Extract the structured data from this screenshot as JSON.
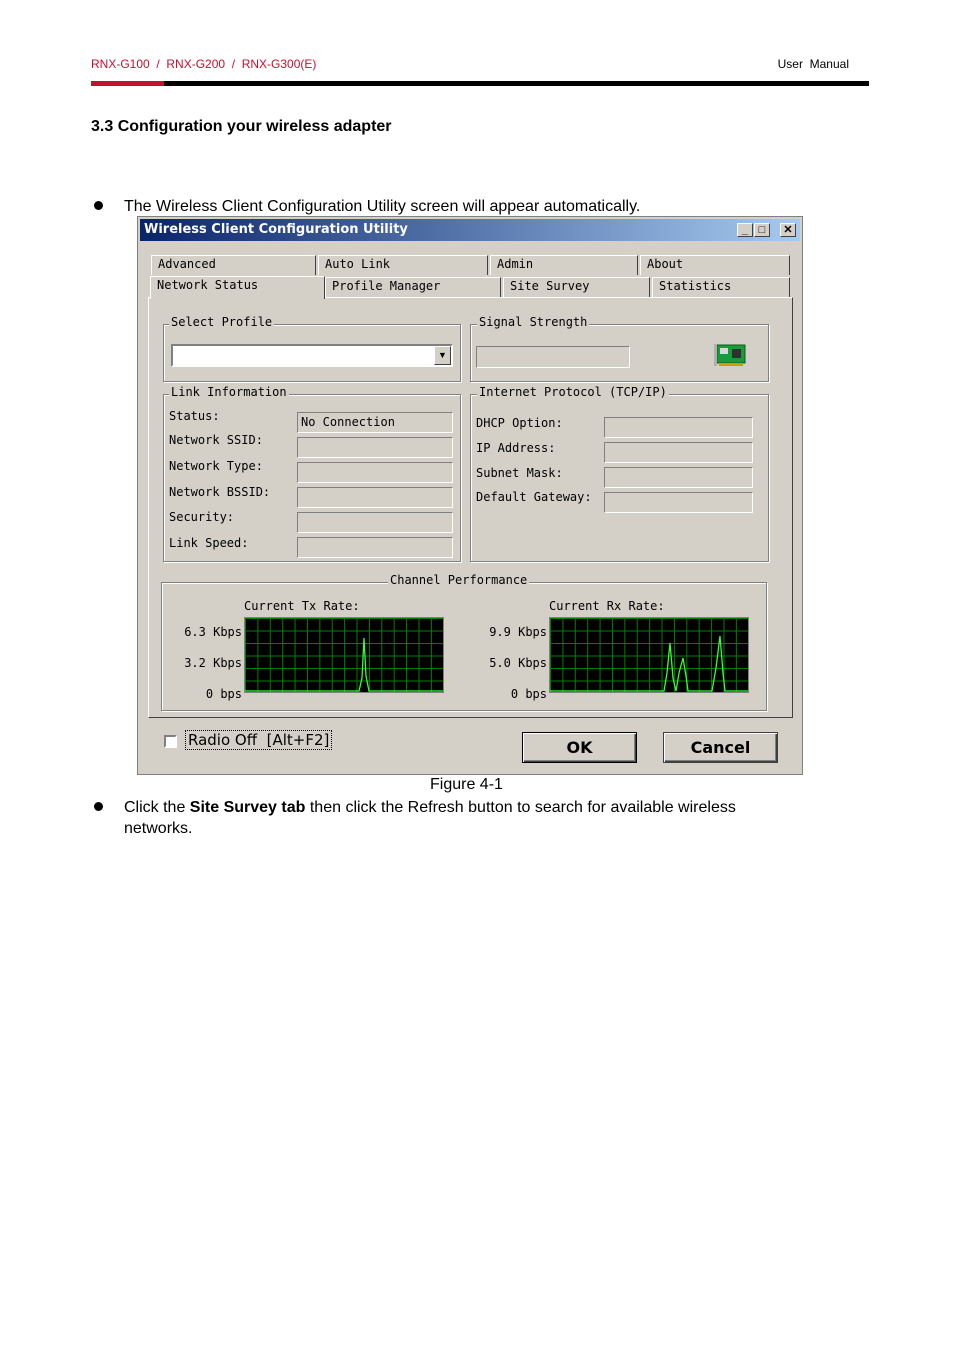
{
  "header": {
    "models": "RNX-G100  /  RNX-G200  /  RNX-G300(E)",
    "manual": "User  Manual"
  },
  "section_title": "3.3 Configuration your wireless adapter",
  "bullets": {
    "first": "The Wireless Client Configuration Utility screen will appear automatically.",
    "second_pre": "Click the ",
    "second_bold": "Site Survey tab",
    "second_post": " then click the Refresh button to search for available wireless",
    "second_line2": "networks."
  },
  "caption": "Figure 4-1",
  "dialog": {
    "title": "Wireless Client Configuration Utility",
    "tabs_back": [
      "Advanced",
      "Auto Link",
      "Admin",
      "About"
    ],
    "tabs_front": [
      "Network Status",
      "Profile Manager",
      "Site Survey",
      "Statistics"
    ],
    "select_profile": {
      "label": "Select Profile",
      "value": ""
    },
    "signal_strength": {
      "label": "Signal Strength"
    },
    "link_info": {
      "label": "Link Information",
      "rows": [
        {
          "label": "Status:",
          "value": "No Connection"
        },
        {
          "label": "Network SSID:",
          "value": ""
        },
        {
          "label": "Network Type:",
          "value": ""
        },
        {
          "label": "Network BSSID:",
          "value": ""
        },
        {
          "label": "Security:",
          "value": ""
        },
        {
          "label": "Link Speed:",
          "value": ""
        }
      ]
    },
    "tcpip": {
      "label": "Internet Protocol  (TCP/IP)",
      "rows": [
        {
          "label": "DHCP Option:",
          "value": ""
        },
        {
          "label": "IP Address:",
          "value": ""
        },
        {
          "label": "Subnet Mask:",
          "value": ""
        },
        {
          "label": "Default Gateway:",
          "value": ""
        }
      ]
    },
    "channel": {
      "label": "Channel Performance",
      "tx": {
        "label": "Current Tx Rate:",
        "ticks": [
          "6.3 Kbps",
          "3.2 Kbps",
          "0 bps"
        ]
      },
      "rx": {
        "label": "Current Rx Rate:",
        "ticks": [
          "9.9 Kbps",
          "5.0 Kbps",
          "0 bps"
        ]
      }
    },
    "radio_off": {
      "label": "Radio Off  [Alt+F2]",
      "checked": false
    },
    "ok": "OK",
    "cancel": "Cancel"
  }
}
